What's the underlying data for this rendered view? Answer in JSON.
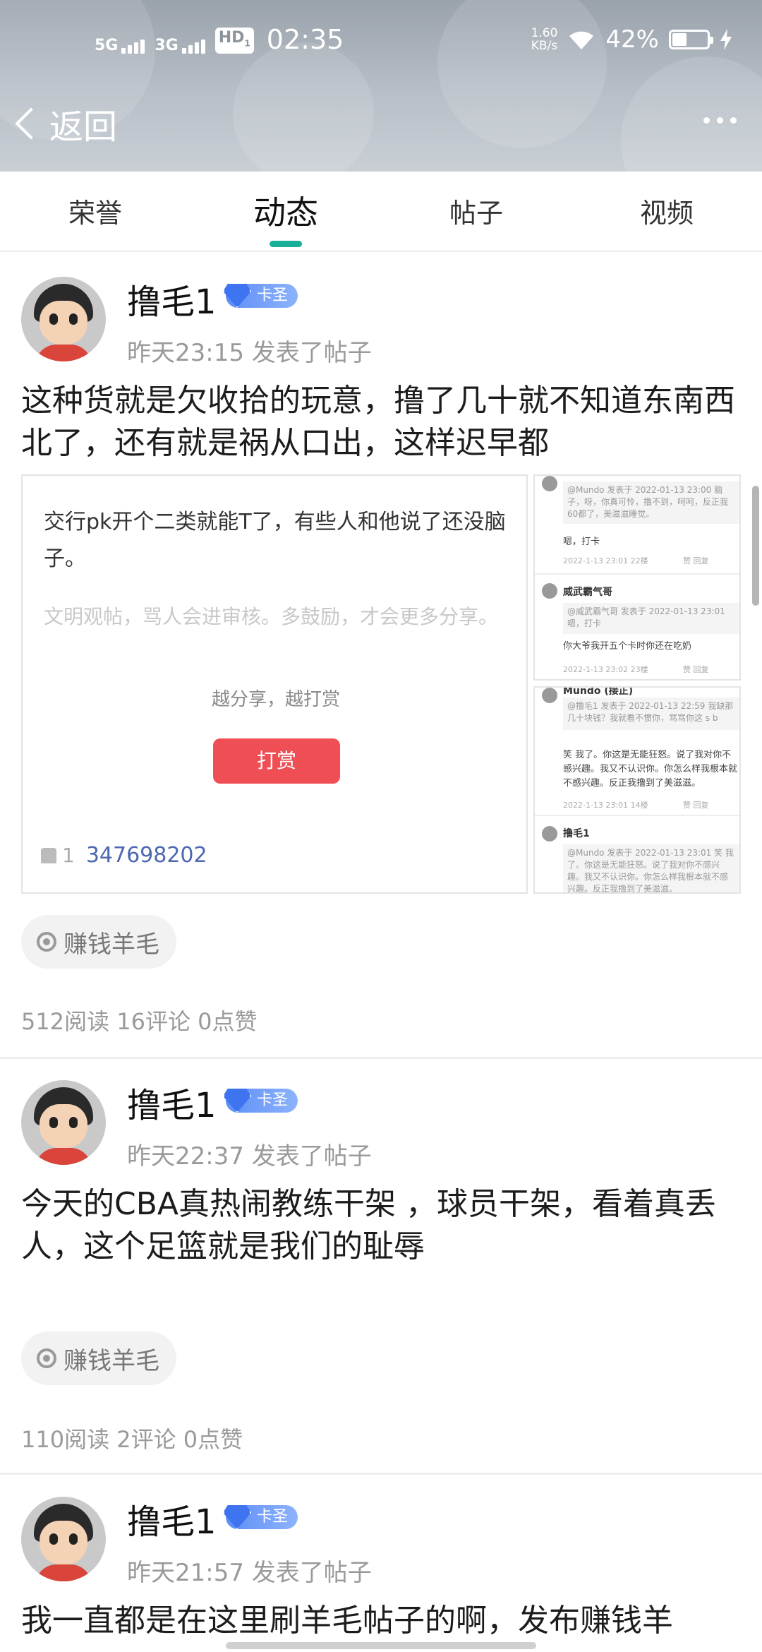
{
  "status_bar": {
    "signal1": "5G",
    "signal2": "3G",
    "hd": "HD",
    "hd_sub": "1",
    "time": "02:35",
    "net_speed_value": "1.60",
    "net_speed_unit": "KB/s",
    "battery_percent": "42%",
    "battery_level": 0.42
  },
  "nav": {
    "back_label": "返回"
  },
  "tabs": [
    {
      "label": "荣誉"
    },
    {
      "label": "动态"
    },
    {
      "label": "帖子"
    },
    {
      "label": "视频"
    }
  ],
  "active_tab": "动态",
  "accent_color": "#1aaf98",
  "posts": [
    {
      "username": "撸毛1",
      "badge": "卡圣",
      "meta": "昨天23:15  发表了帖子",
      "content": "这种货就是欠收拾的玩意，撸了几十就不知道东南西北了，还有就是祸从口出，这样迟早都",
      "tag": "赚钱羊毛",
      "stats": "512阅读 16评论 0点赞",
      "image": {
        "question": "交行pk开个二类就能T了，有些人和他说了还没脑子。",
        "hint": "文明观帖，骂人会进审核。多鼓励，才会更多分享。",
        "share_text": "越分享，越打赏",
        "reward_button": "打赏",
        "like_count": "1",
        "uid": "347698202"
      },
      "thumb1": [
        {
          "name": "",
          "quote": "@Mundo 发表于 2022-01-13 23:00\n脑子，呀，你真可怜，撸不到，呵呵，反正我60都了，美滋滋睡觉。",
          "text": "嗯，打卡",
          "foot": "2022-1-13 23:01  22楼"
        },
        {
          "name": "威武霸气哥",
          "quote": "@威武霸气哥 发表于 2022-01-13 23:01\n嗯，打卡",
          "text": "你大爷我开五个卡时你还在吃奶",
          "foot": "2022-1-13 23:02  23楼"
        }
      ],
      "thumb2": [
        {
          "name": "Mundo (接正)",
          "quote": "@撸毛1 发表于 2022-01-13 22:59\n我缺那几十块钱？我就看不惯你，骂骂你这 s b",
          "text": "笑 我了。你这是无能狂怒。说了我对你不感兴趣。我又不认识你。你怎么样我根本就不感兴趣。反正我撸到了美滋滋。",
          "foot": "2022-1-13 23:01  14楼"
        },
        {
          "name": "撸毛1",
          "quote": "@Mundo 发表于 2022-01-13 23:01\n笑 我了。你这是无能狂怒。说了我对你不感兴趣。我又不认识你。你怎么样我根本就不感兴趣。反正我撸到了美滋滋。",
          "text": "",
          "foot": ""
        }
      ],
      "thumb_actions": "赞  回复"
    },
    {
      "username": "撸毛1",
      "badge": "卡圣",
      "meta": "昨天22:37  发表了帖子",
      "content": "今天的CBA真热闹教练干架 ，球员干架，看着真丢人，这个足篮就是我们的耻辱",
      "tag": "赚钱羊毛",
      "stats": "110阅读 2评论 0点赞"
    },
    {
      "username": "撸毛1",
      "badge": "卡圣",
      "meta": "昨天21:57  发表了帖子",
      "content": "我一直都是在这里刷羊毛帖子的啊，发布赚钱羊"
    }
  ]
}
